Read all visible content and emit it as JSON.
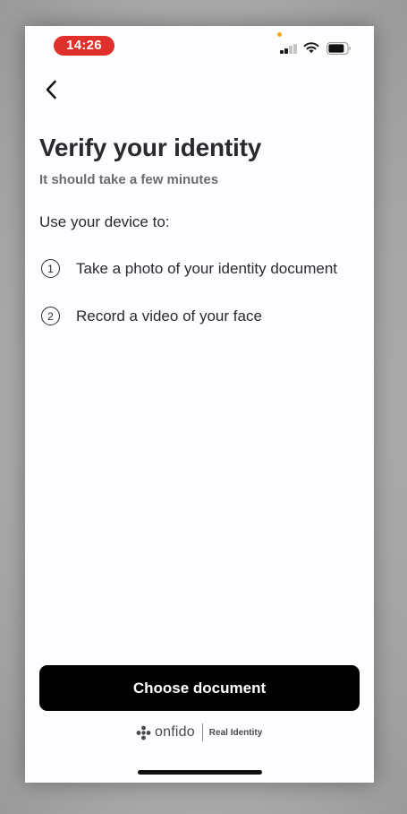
{
  "status_bar": {
    "time": "14:26",
    "time_pill_color": "#e0302c",
    "signal_icon": "cellular-signal-icon",
    "wifi_icon": "wifi-icon",
    "battery_icon": "battery-icon"
  },
  "nav": {
    "back_icon": "chevron-left-icon"
  },
  "header": {
    "title": "Verify your identity",
    "subtitle": "It should take a few minutes"
  },
  "intro": "Use your device to:",
  "steps": [
    {
      "number": "1",
      "text": "Take a photo of your identity document"
    },
    {
      "number": "2",
      "text": "Record a video of your face"
    }
  ],
  "cta": {
    "label": "Choose document",
    "color": "#000000"
  },
  "footer": {
    "logo_icon": "onfido-logo-icon",
    "brand_name": "onfido",
    "tagline": "Real Identity"
  }
}
